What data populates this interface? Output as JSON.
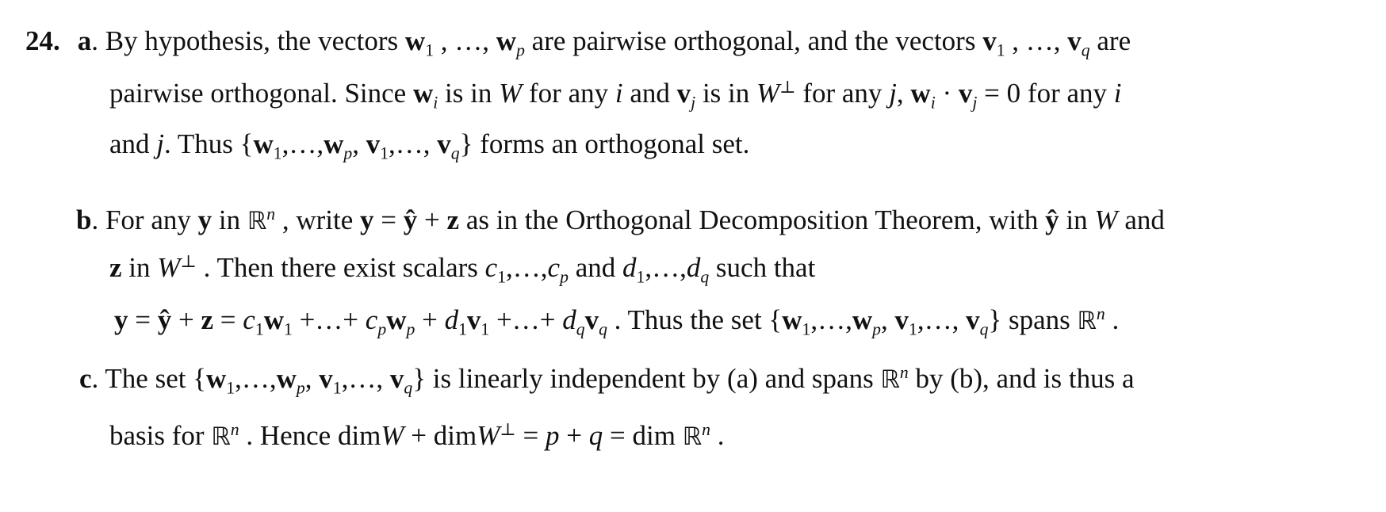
{
  "problem": {
    "number": "24.",
    "parts": [
      {
        "label": "a",
        "lines": [
          "By hypothesis, the vectors w₁ , …, wₚ are pairwise orthogonal, and the vectors v₁ , …, v_q are",
          "pairwise orthogonal. Since wᵢ is in W for any i and vⱼ is in W⊥ for any j, wᵢ · vⱼ = 0 for any i",
          "and j. Thus {w₁,…,wₚ, v₁,…, v_q} forms an orthogonal set."
        ]
      },
      {
        "label": "b",
        "lines": [
          "For any y in ℝⁿ , write y = ŷ + z as in the Orthogonal Decomposition Theorem, with ŷ in W and",
          "z in W⊥ . Then there exist scalars c₁,…,cₚ and d₁,…,d_q such that",
          "y = ŷ + z = c₁w₁ +…+ cₚwₚ + d₁v₁ +…+ d_qv_q . Thus the set {w₁,…,wₚ, v₁,…, v_q} spans ℝⁿ ."
        ]
      },
      {
        "label": "c",
        "lines": [
          "The set {w₁,…,wₚ, v₁,…, v_q} is linearly independent by (a) and spans ℝⁿ by (b), and is thus a",
          "basis for ℝⁿ . Hence dim W + dim W⊥ = p + q = dim ℝⁿ ."
        ]
      }
    ]
  }
}
